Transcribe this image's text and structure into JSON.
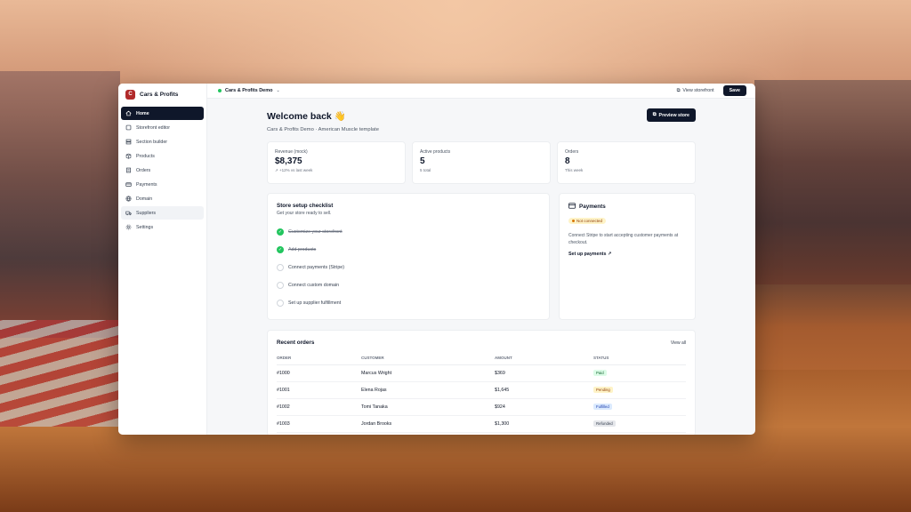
{
  "app": {
    "name": "Cars & Profits",
    "logo_letter": "C"
  },
  "sidebar": {
    "items": [
      {
        "label": "Home",
        "icon": "home-icon",
        "active": true
      },
      {
        "label": "Storefront editor",
        "icon": "store-icon"
      },
      {
        "label": "Section builder",
        "icon": "layers-icon"
      },
      {
        "label": "Products",
        "icon": "box-icon"
      },
      {
        "label": "Orders",
        "icon": "receipt-icon"
      },
      {
        "label": "Payments",
        "icon": "card-icon"
      },
      {
        "label": "Domain",
        "icon": "globe-icon"
      },
      {
        "label": "Suppliers",
        "icon": "truck-icon"
      },
      {
        "label": "Settings",
        "icon": "gear-icon"
      }
    ]
  },
  "topbar": {
    "store_name": "Cars & Profits Demo",
    "view_storefront": "View storefront",
    "save": "Save"
  },
  "welcome": {
    "title": "Welcome back 👋",
    "subtitle": "Cars & Profits Demo · American Muscle template",
    "preview_button": "Preview store"
  },
  "stats": [
    {
      "label": "Revenue (mock)",
      "value": "$8,375",
      "sub": "↗ +12% vs last week"
    },
    {
      "label": "Active products",
      "value": "5",
      "sub": "5 total"
    },
    {
      "label": "Orders",
      "value": "8",
      "sub": "This week"
    }
  ],
  "checklist": {
    "title": "Store setup checklist",
    "subtitle": "Get your store ready to sell.",
    "items": [
      {
        "label": "Customize your storefront",
        "done": true
      },
      {
        "label": "Add products",
        "done": true
      },
      {
        "label": "Connect payments (Stripe)",
        "done": false
      },
      {
        "label": "Connect custom domain",
        "done": false
      },
      {
        "label": "Set up supplier fulfillment",
        "done": false
      }
    ]
  },
  "payments": {
    "title": "Payments",
    "status": "Not connected",
    "description": "Connect Stripe to start accepting customer payments at checkout.",
    "link": "Set up payments ↗"
  },
  "orders": {
    "title": "Recent orders",
    "view_all": "View all",
    "columns": [
      "ORDER",
      "CUSTOMER",
      "AMOUNT",
      "STATUS"
    ],
    "rows": [
      {
        "order": "#1000",
        "customer": "Marcus Wright",
        "amount": "$369",
        "status": "Paid"
      },
      {
        "order": "#1001",
        "customer": "Elena Rojas",
        "amount": "$1,645",
        "status": "Pending"
      },
      {
        "order": "#1002",
        "customer": "Tomi Tanaka",
        "amount": "$924",
        "status": "Fulfilled"
      },
      {
        "order": "#1003",
        "customer": "Jordan Brooks",
        "amount": "$1,300",
        "status": "Refunded"
      }
    ]
  },
  "colors": {
    "accent": "#0f172a",
    "success": "#22c55e",
    "brand": "#b12a2a"
  }
}
